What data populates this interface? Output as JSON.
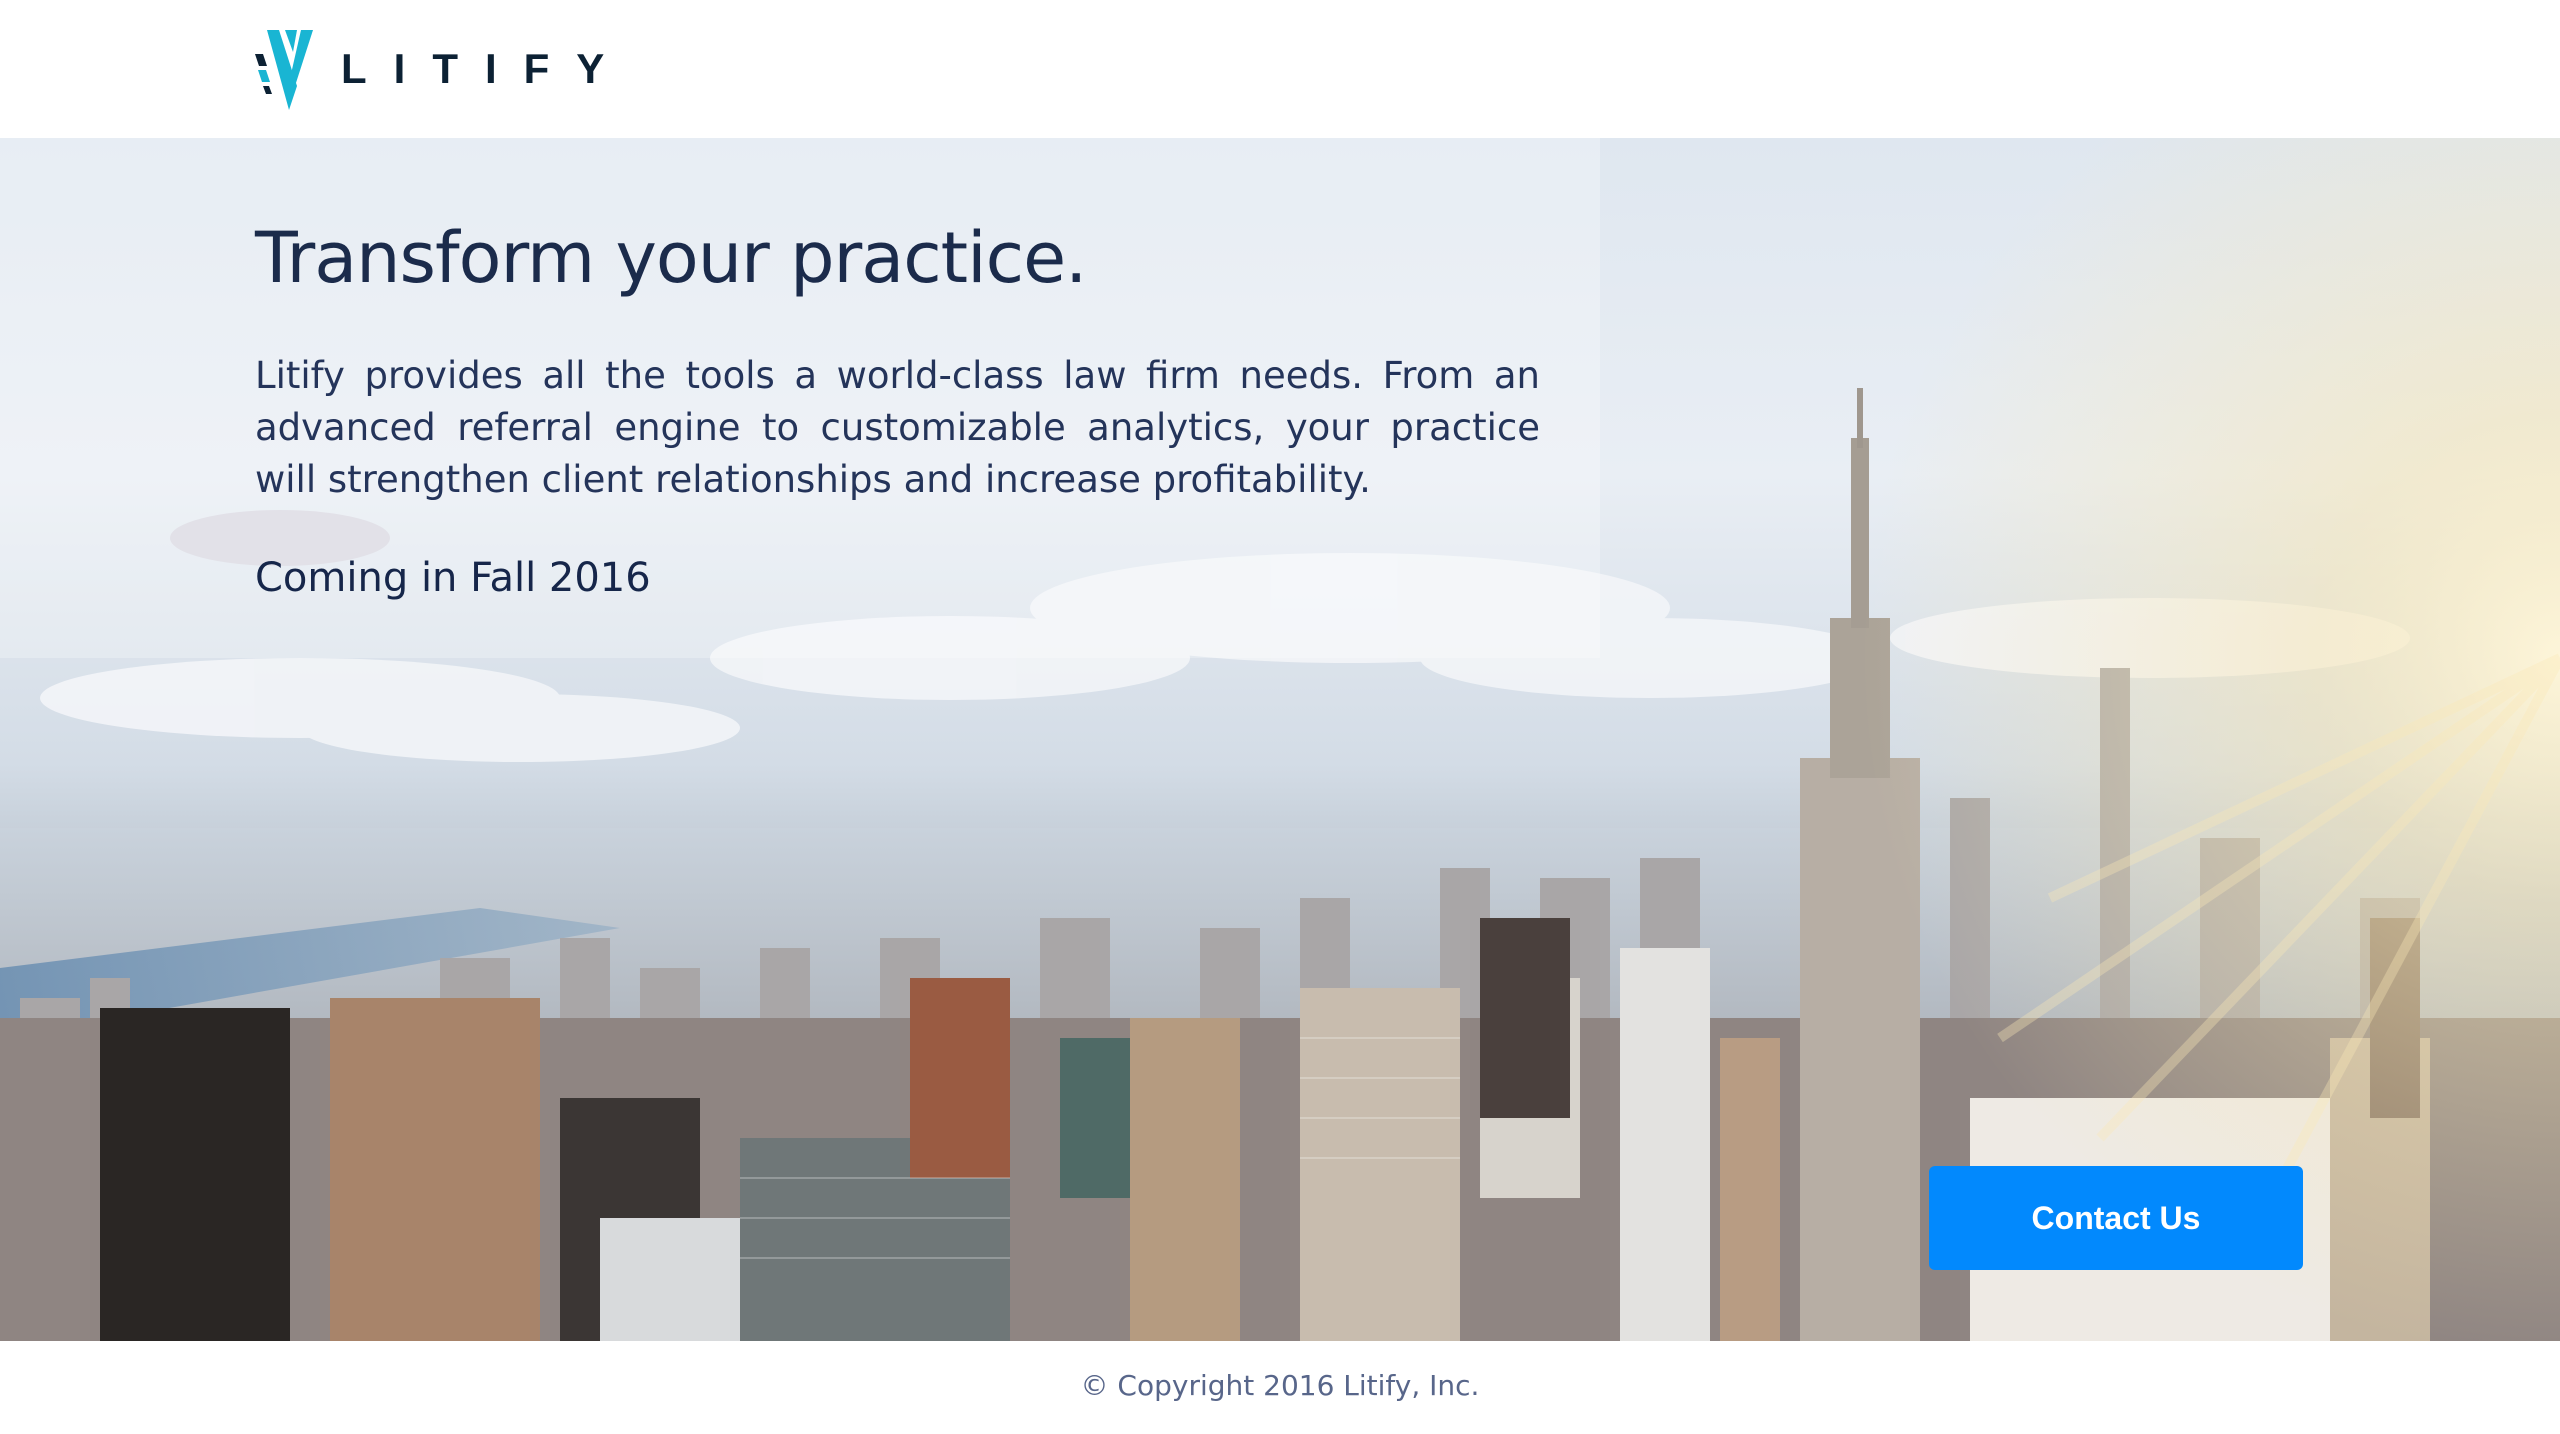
{
  "header": {
    "brand_name": "LITIFY",
    "logo_icon": "litify-logo-icon"
  },
  "hero": {
    "title": "Transform your practice.",
    "description": "Litify provides all the tools a world-class law firm needs. From an advanced referral engine to customizable analytics, your practice will strengthen client relationships and increase profitability.",
    "subtitle": "Coming in Fall 2016",
    "contact_button_label": "Contact Us",
    "background_image": "new-york-city-skyline"
  },
  "footer": {
    "copyright": "© Copyright 2016 Litify, Inc."
  },
  "colors": {
    "brand_cyan": "#19b5d3",
    "brand_navy": "#0c2134",
    "heading_text": "#1b2b4b",
    "button_blue": "#0289fd",
    "footer_text": "#58668a"
  }
}
